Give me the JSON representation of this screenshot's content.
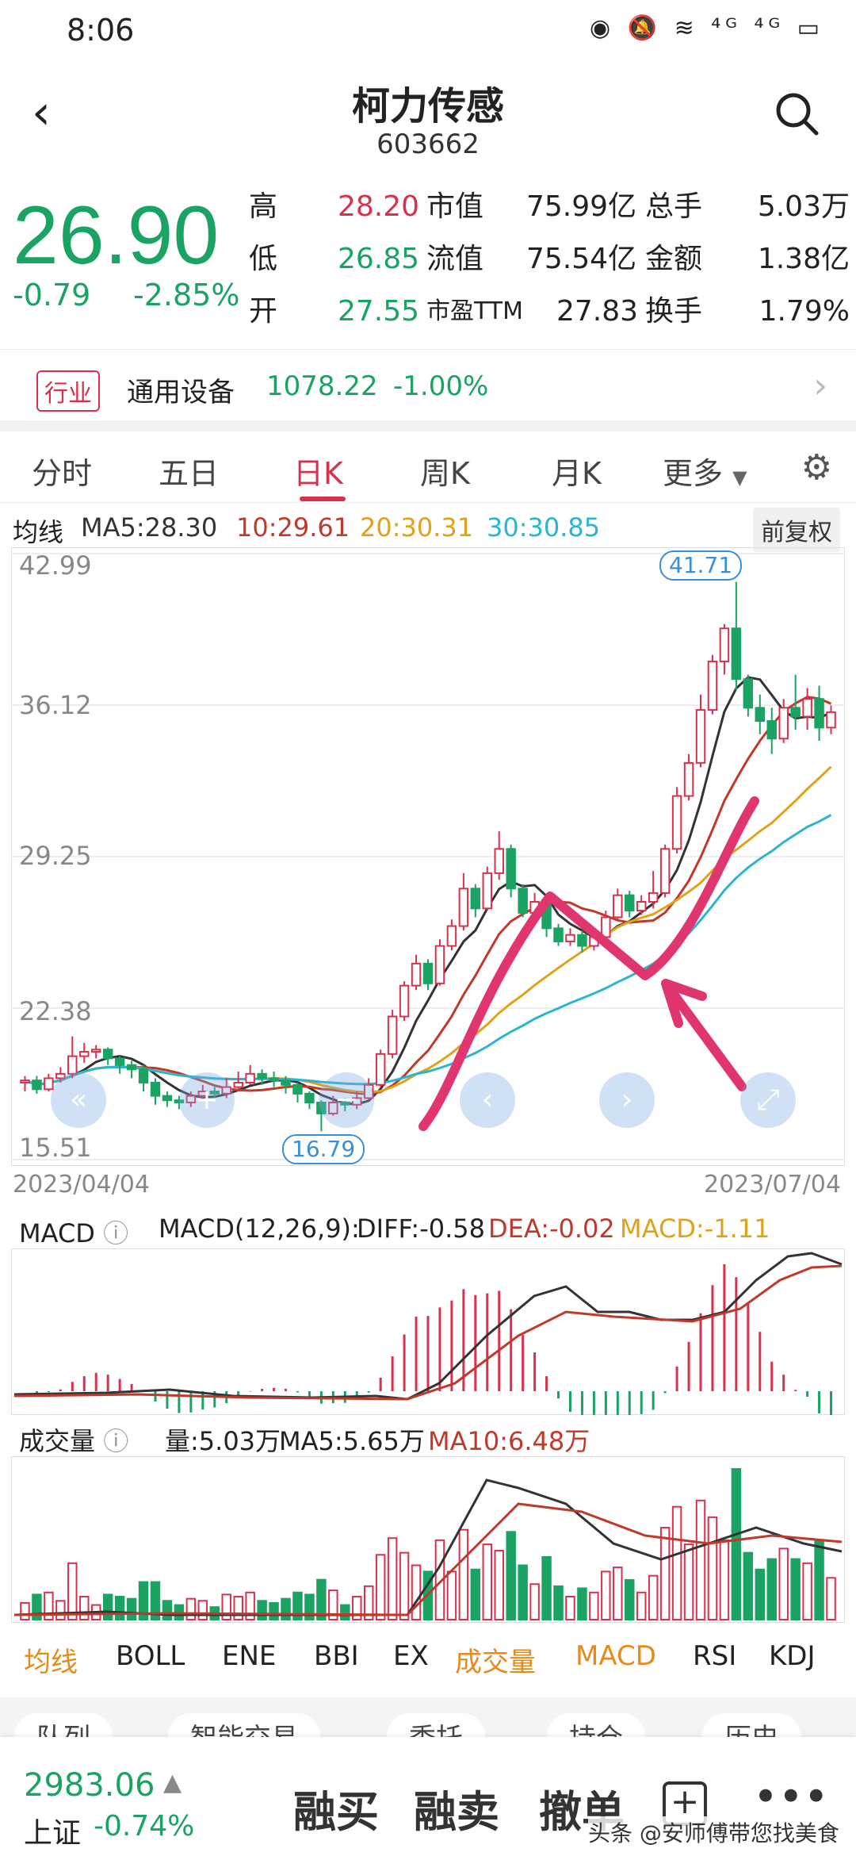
{
  "status": {
    "time": "8:06",
    "icons": "◉ 🔕 ≋ ⁴ᴳ ⁴ᴳ ▭"
  },
  "header": {
    "title": "柯力传感",
    "code": "603662"
  },
  "quote": {
    "price": "26.90",
    "change": "-0.79",
    "change_pct": "-2.85%",
    "high_label": "高",
    "high": "28.20",
    "low_label": "低",
    "low": "26.85",
    "open_label": "开",
    "open": "27.55",
    "mktcap_label": "市值",
    "mktcap": "75.99亿",
    "float_label": "流值",
    "float": "75.54亿",
    "pe_label": "市盈TTM",
    "pe": "27.83",
    "vol_label": "总手",
    "vol": "5.03万",
    "amt_label": "金额",
    "amt": "1.38亿",
    "turn_label": "换手",
    "turn": "1.79%"
  },
  "industry": {
    "badge": "行业",
    "name": "通用设备",
    "value": "1078.22",
    "pct": "-1.00%"
  },
  "tabs": [
    "分时",
    "五日",
    "日K",
    "周K",
    "月K",
    "更多"
  ],
  "ma": {
    "label": "均线",
    "ma5": "MA5:28.30",
    "ma10": "10:29.61",
    "ma20": "20:30.31",
    "ma30": "30:30.85",
    "adjust": "前复权"
  },
  "kline": {
    "y_ticks": [
      "42.99",
      "36.12",
      "29.25",
      "22.38",
      "15.51"
    ],
    "dates": [
      "2023/04/04",
      "2023/07/04"
    ],
    "max_label": "41.71",
    "min_label": "16.79"
  },
  "macd": {
    "title": "MACD",
    "params": "MACD(12,26,9):",
    "diff": "DIFF:-0.58",
    "dea": "DEA:-0.02",
    "macd": "MACD:-1.11"
  },
  "volume": {
    "title": "成交量",
    "vol": "量:5.03万",
    "ma5": "MA5:5.65万",
    "ma10": "MA10:6.48万"
  },
  "indicator_tabs": [
    "均线",
    "BOLL",
    "ENE",
    "BBI",
    "EX",
    "成交量",
    "MACD",
    "RSI",
    "KDJ"
  ],
  "action_tabs": [
    "队列",
    "智能交易",
    "委托",
    "持仓",
    "历史"
  ],
  "bottom": {
    "index_value": "2983.06",
    "index_name": "上证",
    "index_pct": "-0.74%",
    "buy": "融买",
    "sell": "融卖",
    "cancel": "撤单",
    "watermark": "头条 @安师傅带您找美食"
  },
  "colors": {
    "up": "#d9314d",
    "down": "#1aa363",
    "ma5": "#333333",
    "ma10": "#c0392b",
    "ma20": "#e0a21b",
    "ma30": "#2bb5cf"
  },
  "chart_data": {
    "type": "candlestick",
    "ylim": [
      15.51,
      42.99
    ],
    "x_range": [
      "2023/04/04",
      "2023/07/04"
    ],
    "candles": [
      [
        19.0,
        19.1,
        18.6,
        19.3
      ],
      [
        19.1,
        18.7,
        18.5,
        19.3
      ],
      [
        18.7,
        19.2,
        18.6,
        19.4
      ],
      [
        19.2,
        19.4,
        19.0,
        19.7
      ],
      [
        19.4,
        20.2,
        19.2,
        21.1
      ],
      [
        20.2,
        20.4,
        19.9,
        20.8
      ],
      [
        20.4,
        20.5,
        20.1,
        20.7
      ],
      [
        20.5,
        20.1,
        19.8,
        20.6
      ],
      [
        20.1,
        19.8,
        19.4,
        20.2
      ],
      [
        19.8,
        19.6,
        19.2,
        20.0
      ],
      [
        19.6,
        19.0,
        18.6,
        19.8
      ],
      [
        19.0,
        18.4,
        18.0,
        19.2
      ],
      [
        18.4,
        18.2,
        17.9,
        18.6
      ],
      [
        18.2,
        18.1,
        17.8,
        18.4
      ],
      [
        18.1,
        18.4,
        17.9,
        18.6
      ],
      [
        18.4,
        18.6,
        18.2,
        18.9
      ],
      [
        18.6,
        18.5,
        18.3,
        18.8
      ],
      [
        18.5,
        18.8,
        18.3,
        19.2
      ],
      [
        18.8,
        19.0,
        18.6,
        19.5
      ],
      [
        19.0,
        19.4,
        18.9,
        19.8
      ],
      [
        19.4,
        19.2,
        18.9,
        19.6
      ],
      [
        19.2,
        19.1,
        18.8,
        19.5
      ],
      [
        19.1,
        18.9,
        18.5,
        19.3
      ],
      [
        18.9,
        18.5,
        18.1,
        19.0
      ],
      [
        18.5,
        18.1,
        17.8,
        18.6
      ],
      [
        18.1,
        17.6,
        16.79,
        18.2
      ],
      [
        17.6,
        18.1,
        17.5,
        18.4
      ],
      [
        18.1,
        18.0,
        17.7,
        18.3
      ],
      [
        18.0,
        18.3,
        17.8,
        18.6
      ],
      [
        18.3,
        18.9,
        18.2,
        19.2
      ],
      [
        18.9,
        20.3,
        18.8,
        20.5
      ],
      [
        20.3,
        22.0,
        20.1,
        22.3
      ],
      [
        22.0,
        23.4,
        21.8,
        23.6
      ],
      [
        23.4,
        24.4,
        23.2,
        24.8
      ],
      [
        24.4,
        23.5,
        23.2,
        24.6
      ],
      [
        23.5,
        25.2,
        23.4,
        25.5
      ],
      [
        25.2,
        26.1,
        25.0,
        26.4
      ],
      [
        26.1,
        27.8,
        25.9,
        28.5
      ],
      [
        27.8,
        26.9,
        26.5,
        28.0
      ],
      [
        26.9,
        28.5,
        26.8,
        28.8
      ],
      [
        28.5,
        29.6,
        28.2,
        30.4
      ],
      [
        29.6,
        27.8,
        27.4,
        29.8
      ],
      [
        27.8,
        26.7,
        26.5,
        28.0
      ],
      [
        26.7,
        27.2,
        26.4,
        27.6
      ],
      [
        27.2,
        26.0,
        25.6,
        27.4
      ],
      [
        26.0,
        25.4,
        25.2,
        26.2
      ],
      [
        25.4,
        25.7,
        25.2,
        26.0
      ],
      [
        25.7,
        25.2,
        24.9,
        25.9
      ],
      [
        25.2,
        25.6,
        25.0,
        25.9
      ],
      [
        25.6,
        26.5,
        25.4,
        26.8
      ],
      [
        26.5,
        27.5,
        26.3,
        27.8
      ],
      [
        27.5,
        26.8,
        26.5,
        27.7
      ],
      [
        26.8,
        27.2,
        26.6,
        27.5
      ],
      [
        27.2,
        27.6,
        26.9,
        28.6
      ],
      [
        27.6,
        29.6,
        27.4,
        29.8
      ],
      [
        29.6,
        32.0,
        29.4,
        32.4
      ],
      [
        32.0,
        33.5,
        31.8,
        33.9
      ],
      [
        33.5,
        35.9,
        33.3,
        36.6
      ],
      [
        35.9,
        38.1,
        35.7,
        38.4
      ],
      [
        38.1,
        39.6,
        37.5,
        39.8
      ],
      [
        39.6,
        37.3,
        36.8,
        41.71
      ],
      [
        37.3,
        36.0,
        35.6,
        37.5
      ],
      [
        36.0,
        35.4,
        34.8,
        36.6
      ],
      [
        35.4,
        34.6,
        33.9,
        36.0
      ],
      [
        34.6,
        36.0,
        34.4,
        36.4
      ],
      [
        36.0,
        35.6,
        35.0,
        37.5
      ],
      [
        35.6,
        36.4,
        35.0,
        36.9
      ],
      [
        36.4,
        35.1,
        34.5,
        37.0
      ],
      [
        35.1,
        35.8,
        34.8,
        36.1
      ]
    ]
  }
}
